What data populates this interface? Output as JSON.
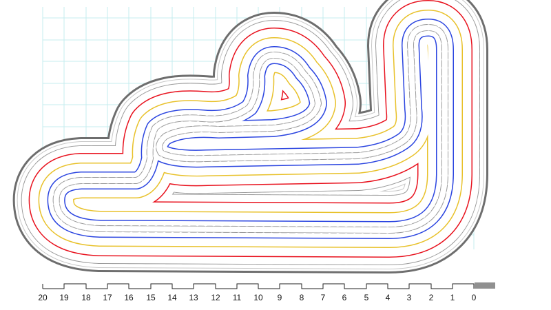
{
  "colors": {
    "grid": "#c4ecef",
    "outline": "#6e6e6e",
    "lane_red": "#e8111d",
    "lane_yellow": "#e8c12a",
    "lane_blue": "#2b45e0",
    "dash": "#9a9a9a",
    "ghost": "#c8c8c8",
    "scale": "#222222"
  },
  "scale": {
    "labels": [
      "20",
      "19",
      "18",
      "17",
      "16",
      "15",
      "14",
      "13",
      "12",
      "11",
      "10",
      "9",
      "8",
      "7",
      "6",
      "5",
      "4",
      "3",
      "2",
      "1",
      "0"
    ]
  }
}
